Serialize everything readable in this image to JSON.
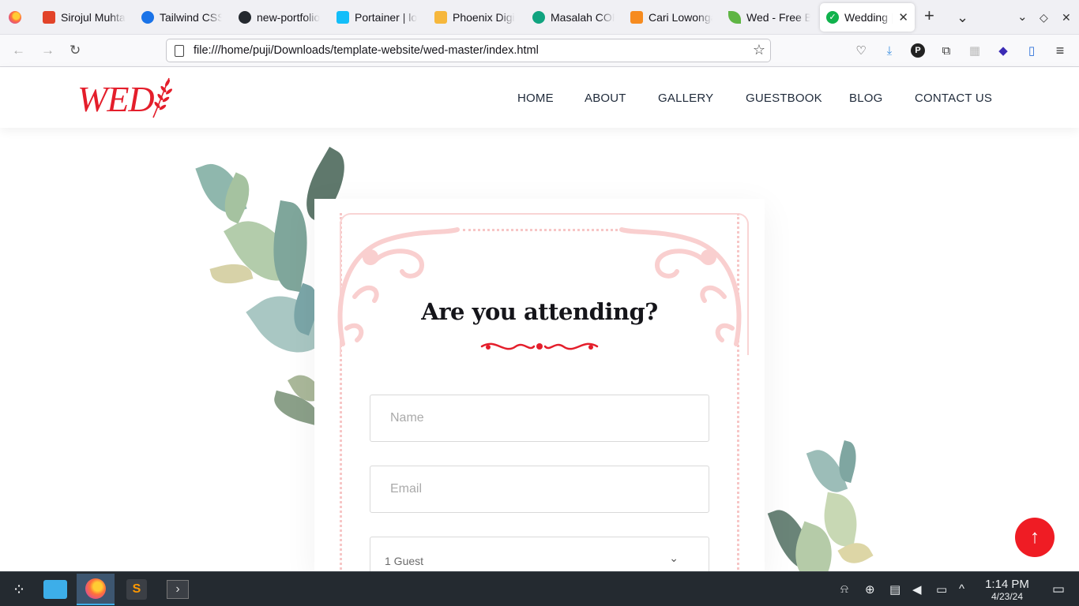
{
  "browser": {
    "tabs": [
      {
        "title": "Sirojul Muhta",
        "favicon": "gitlab-icon",
        "color": "#e24329"
      },
      {
        "title": "Tailwind CSS",
        "favicon": "play-icon",
        "color": "#1a73e8"
      },
      {
        "title": "new-portfolio",
        "favicon": "github-icon",
        "color": "#24292f"
      },
      {
        "title": "Portainer | lo",
        "favicon": "portainer-icon",
        "color": "#13bef9"
      },
      {
        "title": "Phoenix Digi",
        "favicon": "phoenix-icon",
        "color": "#f6b73c"
      },
      {
        "title": "Masalah COR",
        "favicon": "openai-icon",
        "color": "#10a37f"
      },
      {
        "title": "Cari Lowonga",
        "favicon": "jobs-icon",
        "color": "#f68b1f"
      },
      {
        "title": "Wed - Free B",
        "favicon": "leaf-icon",
        "color": "#5fb544"
      },
      {
        "title": "Wedding |",
        "favicon": "check-icon",
        "color": "#10b24c",
        "active": true
      }
    ],
    "url": "file:///home/puji/Downloads/template-website/wed-master/index.html"
  },
  "site": {
    "logo": "WED",
    "nav": [
      "HOME",
      "ABOUT",
      "GALLERY",
      "GUESTBOOK",
      "BLOG",
      "CONTACT US"
    ],
    "rsvp": {
      "heading": "Are you attending?",
      "name_placeholder": "Name",
      "email_placeholder": "Email",
      "guest_selected": "1 Guest"
    },
    "accent": "#e41e2b"
  },
  "taskbar": {
    "time": "1:14 PM",
    "date": "4/23/24"
  }
}
